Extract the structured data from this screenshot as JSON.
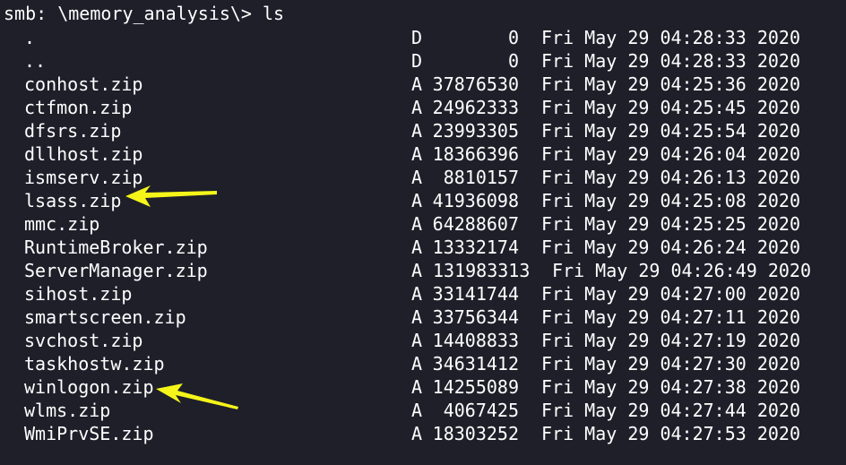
{
  "prompt": {
    "text": "smb: \\memory_analysis\\> ls"
  },
  "entries": [
    {
      "name": ".",
      "attr": "D",
      "size": "0",
      "date": "Fri May 29 04:28:33 2020"
    },
    {
      "name": "..",
      "attr": "D",
      "size": "0",
      "date": "Fri May 29 04:28:33 2020"
    },
    {
      "name": "conhost.zip",
      "attr": "A",
      "size": "37876530",
      "date": "Fri May 29 04:25:36 2020"
    },
    {
      "name": "ctfmon.zip",
      "attr": "A",
      "size": "24962333",
      "date": "Fri May 29 04:25:45 2020"
    },
    {
      "name": "dfsrs.zip",
      "attr": "A",
      "size": "23993305",
      "date": "Fri May 29 04:25:54 2020"
    },
    {
      "name": "dllhost.zip",
      "attr": "A",
      "size": "18366396",
      "date": "Fri May 29 04:26:04 2020"
    },
    {
      "name": "ismserv.zip",
      "attr": "A",
      "size": "8810157",
      "date": "Fri May 29 04:26:13 2020"
    },
    {
      "name": "lsass.zip",
      "attr": "A",
      "size": "41936098",
      "date": "Fri May 29 04:25:08 2020"
    },
    {
      "name": "mmc.zip",
      "attr": "A",
      "size": "64288607",
      "date": "Fri May 29 04:25:25 2020"
    },
    {
      "name": "RuntimeBroker.zip",
      "attr": "A",
      "size": "13332174",
      "date": "Fri May 29 04:26:24 2020"
    },
    {
      "name": "ServerManager.zip",
      "attr": "A",
      "size": "131983313",
      "date": "Fri May 29 04:26:49 2020"
    },
    {
      "name": "sihost.zip",
      "attr": "A",
      "size": "33141744",
      "date": "Fri May 29 04:27:00 2020"
    },
    {
      "name": "smartscreen.zip",
      "attr": "A",
      "size": "33756344",
      "date": "Fri May 29 04:27:11 2020"
    },
    {
      "name": "svchost.zip",
      "attr": "A",
      "size": "14408833",
      "date": "Fri May 29 04:27:19 2020"
    },
    {
      "name": "taskhostw.zip",
      "attr": "A",
      "size": "34631412",
      "date": "Fri May 29 04:27:30 2020"
    },
    {
      "name": "winlogon.zip",
      "attr": "A",
      "size": "14255089",
      "date": "Fri May 29 04:27:38 2020"
    },
    {
      "name": "wlms.zip",
      "attr": "A",
      "size": "4067425",
      "date": "Fri May 29 04:27:44 2020"
    },
    {
      "name": "WmiPrvSE.zip",
      "attr": "A",
      "size": "18303252",
      "date": "Fri May 29 04:27:53 2020"
    }
  ],
  "annotations": {
    "arrow_color": "#f5f51a",
    "arrow_icon": "arrow-left-icon"
  },
  "colors": {
    "background": "#1e1f29",
    "text": "#ffffff"
  }
}
